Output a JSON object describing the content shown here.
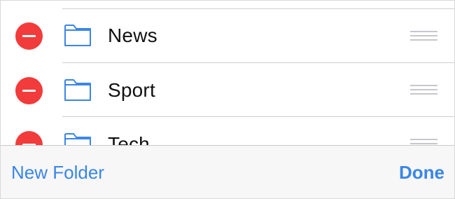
{
  "bookmarks": {
    "folders": [
      {
        "label": "News",
        "icon": "folder-icon"
      },
      {
        "label": "Sport",
        "icon": "folder-icon"
      },
      {
        "label": "Tech",
        "icon": "folder-icon"
      }
    ]
  },
  "toolbar": {
    "new_folder_label": "New Folder",
    "done_label": "Done"
  },
  "colors": {
    "accent": "#3a86e6",
    "delete": "#f23b3b",
    "separator": "#cfcfd3",
    "handle": "#c7c7cc"
  }
}
